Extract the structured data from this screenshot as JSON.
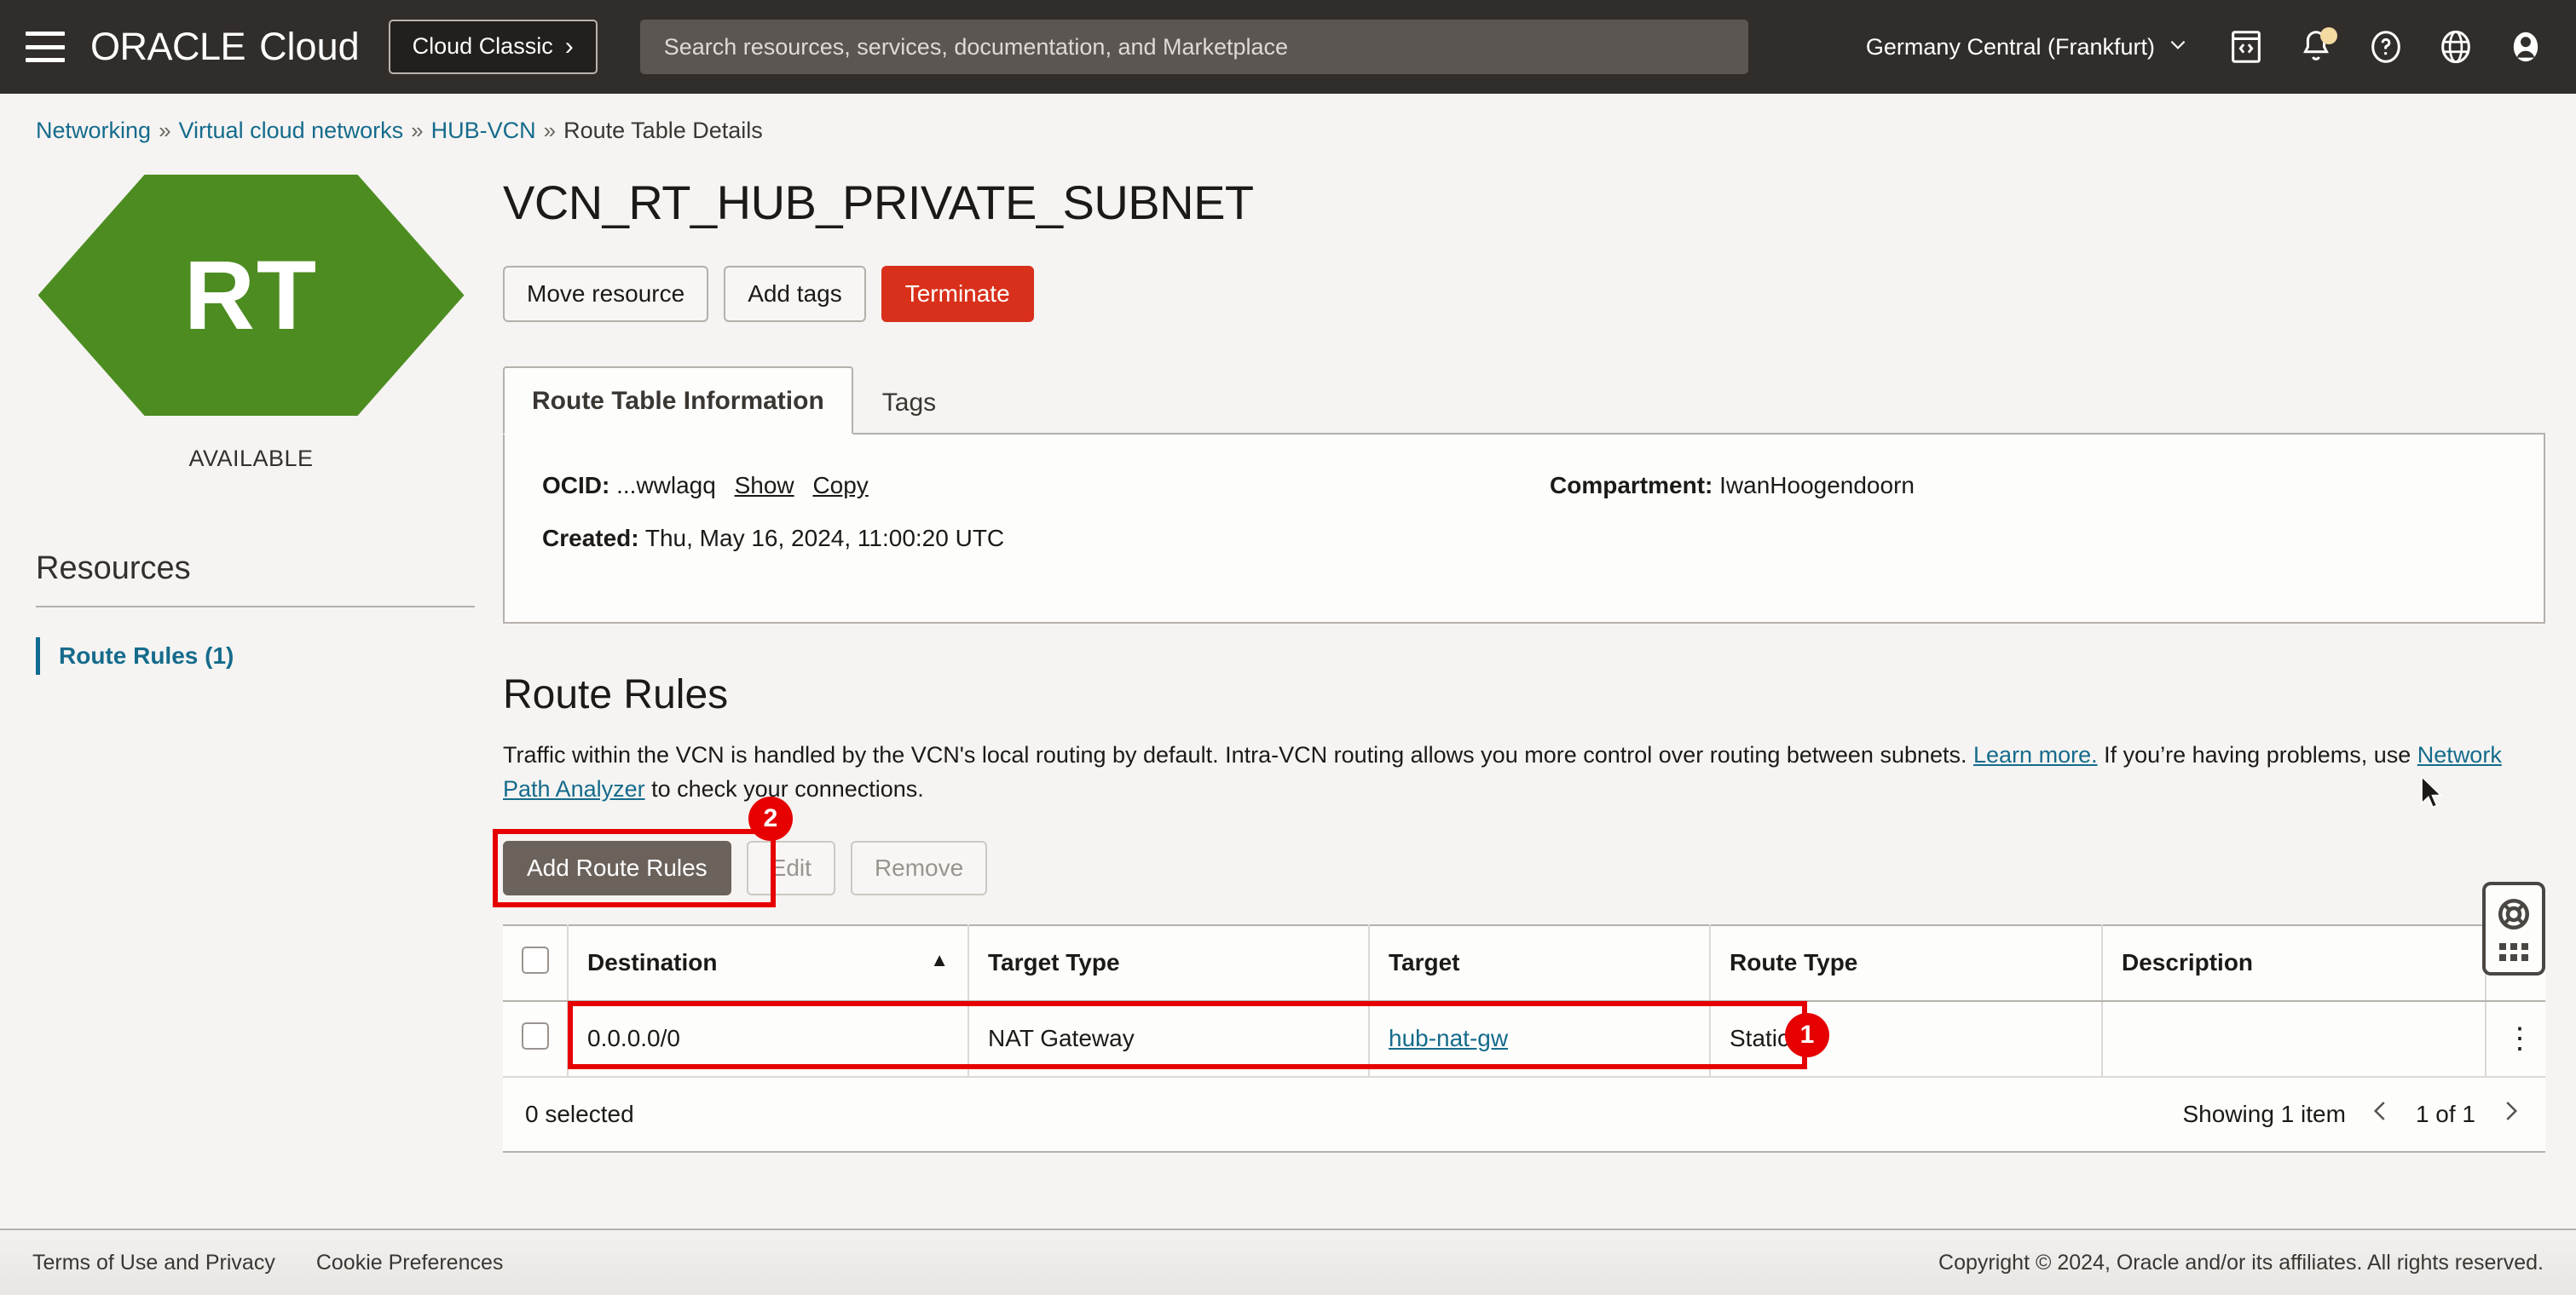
{
  "header": {
    "menu_icon": "hamburger-icon",
    "brand_oracle": "ORACLE",
    "brand_cloud": "Cloud",
    "cloud_classic_label": "Cloud Classic",
    "cloud_classic_chevron": "›",
    "search_placeholder": "Search resources, services, documentation, and Marketplace",
    "search_value": "",
    "region": "Germany Central (Frankfurt)",
    "region_chevron": "⌄",
    "icons": [
      "cloud-shell-icon",
      "notifications-bell-icon",
      "help-question-icon",
      "language-globe-icon",
      "user-avatar-icon"
    ]
  },
  "breadcrumb": {
    "items": [
      {
        "label": "Networking",
        "link": true
      },
      {
        "label": "Virtual cloud networks",
        "link": true
      },
      {
        "label": "HUB-VCN",
        "link": true
      },
      {
        "label": "Route Table Details",
        "link": false
      }
    ],
    "separator": "»"
  },
  "sidebar": {
    "badge_text": "RT",
    "badge_color": "#4d8c21",
    "status": "AVAILABLE",
    "resources_title": "Resources",
    "items": [
      {
        "label": "Route Rules (1)",
        "active": true
      }
    ]
  },
  "page": {
    "title": "VCN_RT_HUB_PRIVATE_SUBNET",
    "actions": [
      {
        "label": "Move resource",
        "style": "default"
      },
      {
        "label": "Add tags",
        "style": "default"
      },
      {
        "label": "Terminate",
        "style": "danger"
      }
    ]
  },
  "tabs": [
    {
      "label": "Route Table Information",
      "active": true
    },
    {
      "label": "Tags",
      "active": false
    }
  ],
  "info_panel": {
    "ocid_label": "OCID:",
    "ocid_value": "...wwlagq",
    "ocid_show": "Show",
    "ocid_copy": "Copy",
    "created_label": "Created:",
    "created_value": "Thu, May 16, 2024, 11:00:20 UTC",
    "compartment_label": "Compartment:",
    "compartment_value": "IwanHoogendoorn"
  },
  "route_rules": {
    "title": "Route Rules",
    "description_part1": "Traffic within the VCN is handled by the VCN's local routing by default. Intra-VCN routing allows you more control over routing between subnets. ",
    "learn_more": "Learn more.",
    "description_part2": " If you’re having problems, use ",
    "network_path_analyzer": "Network Path Analyzer",
    "description_part3": " to check your connections.",
    "toolbar": {
      "add_label": "Add Route Rules",
      "edit_label": "Edit",
      "remove_label": "Remove"
    },
    "table": {
      "columns": [
        "Destination",
        "Target Type",
        "Target",
        "Route Type",
        "Description"
      ],
      "sort_column": "Destination",
      "sort_direction": "▲",
      "rows": [
        {
          "destination": "0.0.0.0/0",
          "target_type": "NAT Gateway",
          "target": "hub-nat-gw",
          "target_is_link": true,
          "route_type": "Static",
          "description": ""
        }
      ]
    },
    "footer": {
      "selected_text": "0 selected",
      "showing_text": "Showing 1 item",
      "page_text": "1 of 1",
      "prev_arrow": "‹",
      "next_arrow": "›"
    }
  },
  "annotations": [
    {
      "id": "1",
      "target": "route-rule-row"
    },
    {
      "id": "2",
      "target": "add-route-rules-button"
    }
  ],
  "help_widget": {
    "icon": "lifebuoy-icon",
    "handle": "drag-dots-handle"
  },
  "footer": {
    "terms": "Terms of Use and Privacy",
    "cookies": "Cookie Preferences",
    "copyright": "Copyright © 2024, Oracle and/or its affiliates. All rights reserved."
  },
  "colors": {
    "accent_link": "#156b8c",
    "danger": "#d9301b",
    "annotation": "#e60000",
    "status_green": "#4d8c21",
    "topbar": "#312d2a"
  }
}
